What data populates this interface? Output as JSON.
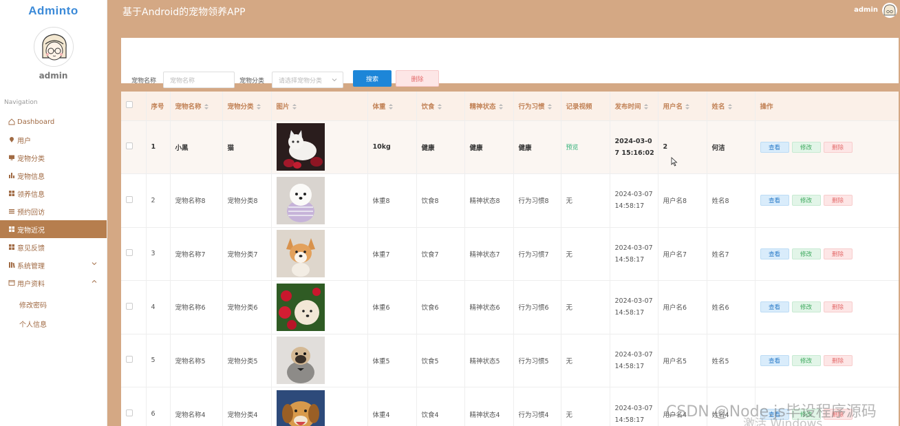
{
  "sidebar": {
    "brand": "Adminto",
    "username": "admin",
    "nav_title": "Navigation",
    "items": [
      {
        "label": "Dashboard",
        "icon": "home-icon"
      },
      {
        "label": "用户",
        "icon": "user-icon"
      },
      {
        "label": "宠物分类",
        "icon": "monitor-icon"
      },
      {
        "label": "宠物信息",
        "icon": "bar-chart-icon"
      },
      {
        "label": "领养信息",
        "icon": "grid-icon"
      },
      {
        "label": "预约回访",
        "icon": "list-icon"
      },
      {
        "label": "宠物近况",
        "icon": "grid-icon"
      },
      {
        "label": "意见反馈",
        "icon": "grid-icon"
      },
      {
        "label": "系统管理",
        "icon": "library-icon"
      },
      {
        "label": "用户资料",
        "icon": "profile-icon"
      }
    ],
    "active_index": 6,
    "sub_items": [
      "修改密码",
      "个人信息"
    ]
  },
  "header": {
    "title": "基于Android的宠物领养APP",
    "user": "admin"
  },
  "search": {
    "name_label": "宠物名称",
    "name_placeholder": "宠物名称",
    "category_label": "宠物分类",
    "category_placeholder": "请选择宠物分类",
    "search_button": "搜索",
    "delete_button": "删除"
  },
  "table": {
    "headers": [
      "序号",
      "宠物名称",
      "宠物分类",
      "图片",
      "体重",
      "饮食",
      "精神状态",
      "行为习惯",
      "记录视频",
      "发布时间",
      "用户名",
      "姓名",
      "操作"
    ],
    "rows": [
      {
        "no": "1",
        "name": "小黑",
        "category": "猫",
        "weight": "10kg",
        "diet": "健康",
        "mental": "健康",
        "behavior": "健康",
        "video": "预览",
        "time1": "2024-03-0",
        "time2": "7 15:16:02",
        "username": "2",
        "realname": "何洁"
      },
      {
        "no": "2",
        "name": "宠物名称8",
        "category": "宠物分类8",
        "weight": "体重8",
        "diet": "饮食8",
        "mental": "精神状态8",
        "behavior": "行为习惯8",
        "video": "无",
        "time1": "2024-03-07",
        "time2": "14:58:17",
        "username": "用户名8",
        "realname": "姓名8"
      },
      {
        "no": "3",
        "name": "宠物名称7",
        "category": "宠物分类7",
        "weight": "体重7",
        "diet": "饮食7",
        "mental": "精神状态7",
        "behavior": "行为习惯7",
        "video": "无",
        "time1": "2024-03-07",
        "time2": "14:58:17",
        "username": "用户名7",
        "realname": "姓名7"
      },
      {
        "no": "4",
        "name": "宠物名称6",
        "category": "宠物分类6",
        "weight": "体重6",
        "diet": "饮食6",
        "mental": "精神状态6",
        "behavior": "行为习惯6",
        "video": "无",
        "time1": "2024-03-07",
        "time2": "14:58:17",
        "username": "用户名6",
        "realname": "姓名6"
      },
      {
        "no": "5",
        "name": "宠物名称5",
        "category": "宠物分类5",
        "weight": "体重5",
        "diet": "饮食5",
        "mental": "精神状态5",
        "behavior": "行为习惯5",
        "video": "无",
        "time1": "2024-03-07",
        "time2": "14:58:17",
        "username": "用户名5",
        "realname": "姓名5"
      },
      {
        "no": "6",
        "name": "宠物名称4",
        "category": "宠物分类4",
        "weight": "体重4",
        "diet": "饮食4",
        "mental": "精神状态4",
        "behavior": "行为习惯4",
        "video": "无",
        "time1": "2024-03-07",
        "time2": "14:58:17",
        "username": "用户名4",
        "realname": "姓名4"
      }
    ],
    "actions": {
      "view": "查看",
      "edit": "修改",
      "delete": "删除"
    }
  },
  "watermark": "CSDN @Node.js毕设程序源码",
  "watermark2": "激活 Windows",
  "colors": {
    "header_bg": "#d4a884",
    "sidebar_active": "#b67e4e",
    "primary": "#1d86d8",
    "danger": "#e46c6c",
    "success": "#3ba85b"
  }
}
